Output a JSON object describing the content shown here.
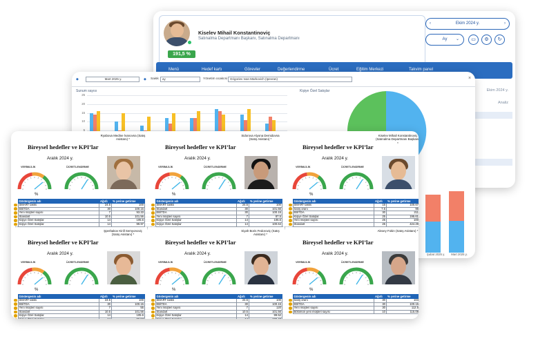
{
  "colors": {
    "accent": "#2b6dc0",
    "success": "#3aa64c",
    "warning": "#e2a200"
  },
  "profile": {
    "name": "Kiselev Mihail Konstantinoviç",
    "role": "Satınalma Departmanı Başkanı, Satınalma Departmanı",
    "score": "191,5 %"
  },
  "header": {
    "period": "Ekim 2024 y.",
    "period_short": "Ay",
    "side_period": "Ekim 2024 y.",
    "side_item": "Analiz"
  },
  "nav": [
    "Menü",
    "Hedef kartı",
    "Görevler",
    "Değerlendirme",
    "Ücret",
    "Eğitim Merkezi",
    "Takvim panel"
  ],
  "filters": {
    "date": "Mart 2025 y.",
    "scale_label": "Saisk",
    "scale_value": "ay",
    "manager_label": "Yönetim ocakcsi",
    "manager_value": "Grigoriev Ivan Markovich (Ipevran)"
  },
  "sales_chart": {
    "title": "Sunum sayısı",
    "right_title": "Kişiye Özel Satışlar",
    "months_right": [
      "Şubat 2025 y.",
      "Mart 2025 y."
    ]
  },
  "chart_data": {
    "type": "bar",
    "title": "Sunum sayısı",
    "ylim": [
      0,
      25
    ],
    "yticks": [
      0,
      5,
      10,
      15,
      20,
      25
    ],
    "series": [
      {
        "color": "#52b3ef",
        "values": [
          15,
          10,
          8,
          12,
          12,
          17,
          14,
          9
        ]
      },
      {
        "color": "#f28068",
        "values": [
          14,
          5,
          5,
          9,
          12,
          16,
          11,
          13
        ]
      },
      {
        "color": "#f7bf25",
        "values": [
          16,
          15,
          13,
          15,
          16,
          14,
          17,
          11
        ]
      },
      {
        "color": "#5cc15c",
        "values": [
          4,
          4,
          3,
          4,
          4,
          3,
          3,
          4
        ]
      }
    ]
  },
  "kpi_labels": {
    "title": "Bireysel hedefler ve KPI’lar",
    "period": "Aralık 2024 y.",
    "gauge_left": "VERİMLİLİK",
    "gauge_right": "ÜCRETLENDİRME",
    "percent": "%",
    "col_name": "Göstergenin adı",
    "col_weight": "Ağırlı",
    "col_done": "% yerine getirme"
  },
  "cards": [
    {
      "person": "Ryabova Medine İvanovna (Satış Asistanı) *",
      "rows": [
        [
          "SMART tasks",
          "24.5",
          "100"
        ],
        [
          "EBİTDA",
          "30",
          "100.15"
        ],
        [
          "Yeni müşteri sayısı",
          "7",
          "93.33"
        ],
        [
          "Standart",
          "10.5",
          "101.56"
        ],
        [
          "Kişiye Özel Satışlar",
          "14",
          "105.6"
        ],
        [
          "Kişiye Özel Satışlar",
          "14",
          "99.97"
        ]
      ]
    },
    {
      "person": "Sidorova Alyona Demidovna (Satış Asistanı) *",
      "rows": [
        [
          "SMART tasks",
          "24.5",
          "100"
        ],
        [
          "Standart",
          "30",
          "101.56"
        ],
        [
          "EBİTDA",
          "30",
          "100.15"
        ],
        [
          "Yeni müşteri sayısı",
          "7",
          "87.5"
        ],
        [
          "Kişiye Özel Satışlar",
          "14",
          "105.6"
        ],
        [
          "Kişiye Özel Satışlar",
          "14",
          "100.64"
        ]
      ]
    },
    {
      "person": "Kiselev Mihail Konstantinoviç (Satınalma Departmanı Başkanı) *",
      "rows": [
        [
          "SMART tasks",
          "15",
          "100.67"
        ],
        [
          "Satış oranı",
          "7.5",
          "96"
        ],
        [
          "EBİTDA",
          "30",
          "211"
        ],
        [
          "Kişiye Özel Satışlar",
          "25",
          "195.61"
        ],
        [
          "Yeni müşteri sayısı",
          "25",
          "100"
        ],
        [
          "Standart",
          "25",
          "424.29"
        ]
      ]
    },
    {
      "person": "Şperbakov Kirill Semyonoviç (Satış Asistanı) *",
      "rows": [
        [
          "SMART tasks",
          "24.5",
          "100"
        ],
        [
          "EBİTDA",
          "30",
          "100.15"
        ],
        [
          "Yeni müşteri sayısı",
          "7",
          "55"
        ],
        [
          "Standart",
          "10.5",
          "101.56"
        ],
        [
          "Kişiye Özel Satışlar",
          "14",
          "105.6"
        ],
        [
          "Kişiye Özel Satışlar",
          "14",
          "86.57"
        ]
      ]
    },
    {
      "person": "Siyah Boris Fedoroviç (Satış Asistanı) *",
      "rows": [
        [
          "SMART tasks",
          "24.5",
          "100"
        ],
        [
          "EBİTDA",
          "30",
          "100.15"
        ],
        [
          "Yeni müşteri sayısı",
          "7",
          "120"
        ],
        [
          "Standart",
          "10.5",
          "101.56"
        ],
        [
          "Kişiye Özel Satışlar",
          "14",
          "99.52"
        ],
        [
          "Kişiye Özel Satışlar",
          "14",
          "109.47"
        ]
      ]
    },
    {
      "person": "Alexey Fokin (Satış Asistanı) *",
      "rows": [
        [
          "Satış oranı",
          "30",
          "104"
        ],
        [
          "EBİTDA",
          "30",
          "100.15"
        ],
        [
          "Yeni müşteri sayısı",
          "30",
          "112.5"
        ],
        [
          "Bölümün yeni müşteri sayısı",
          "10",
          "115.08"
        ]
      ]
    }
  ]
}
